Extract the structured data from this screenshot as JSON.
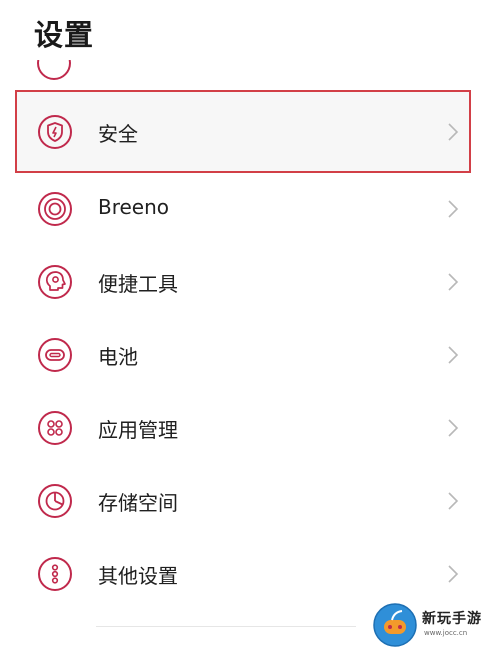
{
  "header": {
    "title": "设置"
  },
  "settings_list": [
    {
      "label": "安全",
      "icon": "security-shield-icon",
      "highlighted": true
    },
    {
      "label": "Breeno",
      "icon": "breeno-icon"
    },
    {
      "label": "便捷工具",
      "icon": "convenience-tools-icon"
    },
    {
      "label": "电池",
      "icon": "battery-icon"
    },
    {
      "label": "应用管理",
      "icon": "app-management-icon"
    },
    {
      "label": "存储空间",
      "icon": "storage-icon"
    },
    {
      "label": "其他设置",
      "icon": "other-settings-icon"
    }
  ],
  "watermark": {
    "text": "新玩手游",
    "url": "www.jocc.cn"
  },
  "colors": {
    "accent": "#c0294c",
    "highlight_border": "#d23f47",
    "chevron": "#b8b8b8"
  }
}
